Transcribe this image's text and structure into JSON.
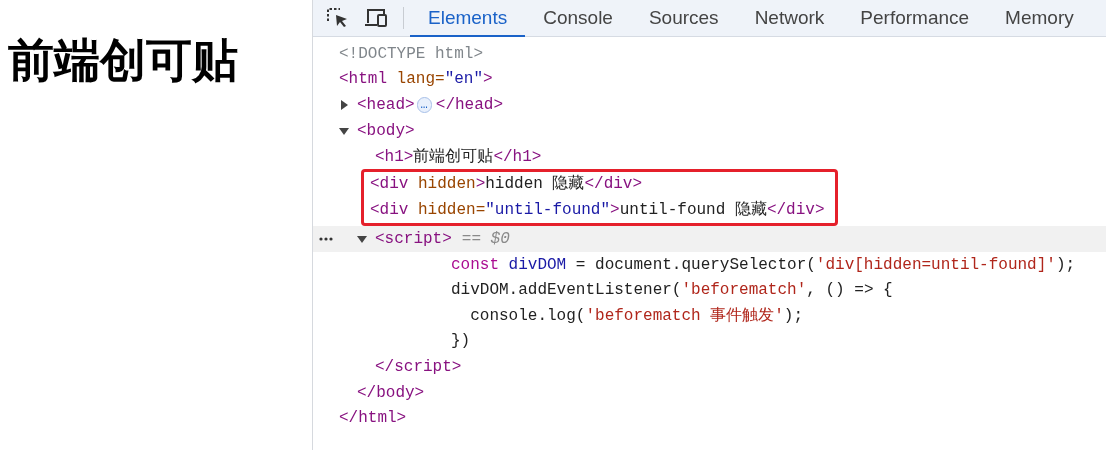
{
  "page": {
    "heading": "前端创可贴"
  },
  "devtools": {
    "tabs": [
      {
        "label": "Elements",
        "selected": true
      },
      {
        "label": "Console",
        "selected": false
      },
      {
        "label": "Sources",
        "selected": false
      },
      {
        "label": "Network",
        "selected": false
      },
      {
        "label": "Performance",
        "selected": false
      },
      {
        "label": "Memory",
        "selected": false
      }
    ],
    "tree": [
      {
        "tokens": [
          {
            "kind": "comment",
            "t": "<!DOCTYPE html>"
          }
        ]
      },
      {
        "tokens": [
          {
            "kind": "tag",
            "t": "<html "
          },
          {
            "kind": "attr",
            "t": "lang="
          },
          {
            "kind": "value",
            "t": "\"en\""
          },
          {
            "kind": "tag",
            "t": ">"
          }
        ],
        "close": [
          {
            "kind": "tag",
            "t": "</html>"
          }
        ],
        "children": [
          {
            "expanded": false,
            "tokens": [
              {
                "kind": "tag",
                "t": "<head>"
              }
            ],
            "badge": "…",
            "close": [
              {
                "kind": "tag",
                "t": "</head>"
              }
            ]
          },
          {
            "expanded": true,
            "tokens": [
              {
                "kind": "tag",
                "t": "<body>"
              }
            ],
            "close": [
              {
                "kind": "tag",
                "t": "</body>"
              }
            ],
            "children": [
              {
                "tokens": [
                  {
                    "kind": "tag",
                    "t": "<h1>"
                  },
                  {
                    "kind": "text",
                    "t": "前端创可贴"
                  },
                  {
                    "kind": "tag",
                    "t": "</h1>"
                  }
                ]
              },
              {
                "highlighted": true,
                "tokens": [
                  {
                    "kind": "tag",
                    "t": "<div "
                  },
                  {
                    "kind": "attr",
                    "t": "hidden"
                  },
                  {
                    "kind": "tag",
                    "t": ">"
                  },
                  {
                    "kind": "text",
                    "t": "hidden 隐藏"
                  },
                  {
                    "kind": "tag",
                    "t": "</div>"
                  }
                ]
              },
              {
                "highlighted": true,
                "tokens": [
                  {
                    "kind": "tag",
                    "t": "<div "
                  },
                  {
                    "kind": "attr",
                    "t": "hidden="
                  },
                  {
                    "kind": "value",
                    "t": "\"until-found\""
                  },
                  {
                    "kind": "tag",
                    "t": ">"
                  },
                  {
                    "kind": "text",
                    "t": "until-found 隐藏"
                  },
                  {
                    "kind": "tag",
                    "t": "</div>"
                  }
                ]
              },
              {
                "expanded": true,
                "selected": true,
                "suffix": "== $0",
                "tokens": [
                  {
                    "kind": "tag",
                    "t": "<script>"
                  }
                ],
                "close": [
                  {
                    "kind": "tag",
                    "t": "</script>"
                  }
                ],
                "script_lines": [
                  [
                    {
                      "kind": "keyword",
                      "t": "const "
                    },
                    {
                      "kind": "ident",
                      "t": "divDOM"
                    },
                    {
                      "kind": "text",
                      "t": " = document.querySelector("
                    },
                    {
                      "kind": "string",
                      "t": "'div[hidden=until-found]'"
                    },
                    {
                      "kind": "text",
                      "t": ");"
                    }
                  ],
                  [
                    {
                      "kind": "text",
                      "t": "divDOM.addEventListener("
                    },
                    {
                      "kind": "string",
                      "t": "'beforematch'"
                    },
                    {
                      "kind": "text",
                      "t": ", () => {"
                    }
                  ],
                  [
                    {
                      "kind": "text",
                      "t": "  console.log("
                    },
                    {
                      "kind": "string",
                      "t": "'beforematch 事件触发'"
                    },
                    {
                      "kind": "text",
                      "t": ");"
                    }
                  ],
                  [
                    {
                      "kind": "text",
                      "t": "})"
                    }
                  ]
                ]
              }
            ]
          }
        ]
      }
    ]
  }
}
